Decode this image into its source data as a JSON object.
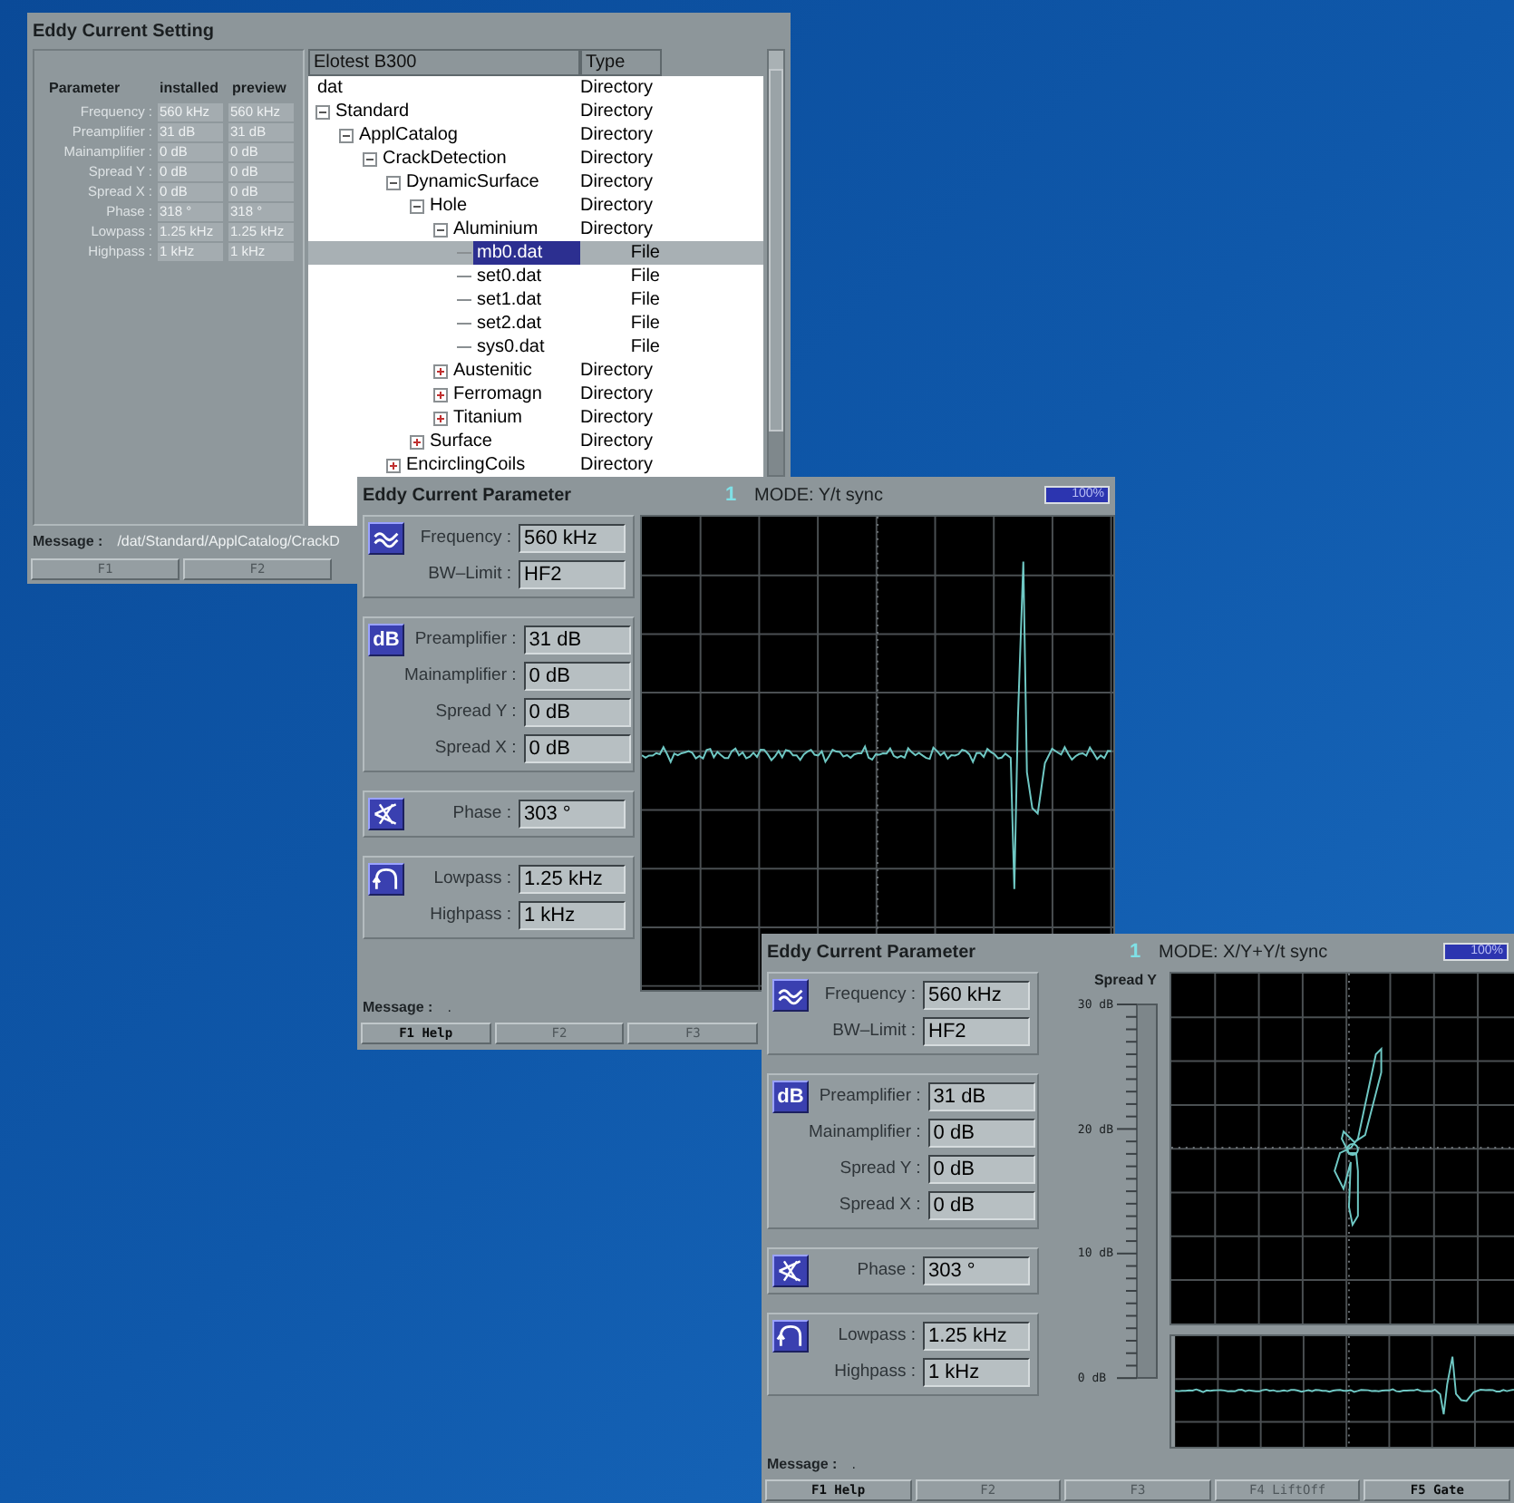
{
  "windows": [
    {
      "kind": "setting",
      "title": "Eddy Current Setting",
      "parameters": {
        "columns": [
          "Parameter",
          "installed",
          "preview"
        ],
        "rows": [
          {
            "label": "Frequency :",
            "installed": "560 kHz",
            "preview": "560 kHz"
          },
          {
            "label": "Preamplifier :",
            "installed": "31 dB",
            "preview": "31 dB"
          },
          {
            "label": "Mainamplifier :",
            "installed": "0 dB",
            "preview": "0 dB"
          },
          {
            "label": "Spread Y :",
            "installed": "0 dB",
            "preview": "0 dB"
          },
          {
            "label": "Spread X :",
            "installed": "0 dB",
            "preview": "0 dB"
          },
          {
            "label": "Phase :",
            "installed": "318 °",
            "preview": "318 °"
          },
          {
            "label": "Lowpass :",
            "installed": "1.25 kHz",
            "preview": "1.25 kHz"
          },
          {
            "label": "Highpass :",
            "installed": "1 kHz",
            "preview": "1 kHz"
          }
        ]
      },
      "tree": {
        "columns": [
          "Elotest B300",
          "Type"
        ],
        "items": [
          {
            "name": "dat",
            "type": "Directory",
            "selected": false,
            "children": [
              {
                "name": "Standard",
                "type": "Directory",
                "expanded": true,
                "selected": false,
                "children": [
                  {
                    "name": "ApplCatalog",
                    "type": "Directory",
                    "expanded": true,
                    "selected": false,
                    "children": [
                      {
                        "name": "CrackDetection",
                        "type": "Directory",
                        "expanded": true,
                        "selected": false,
                        "children": [
                          {
                            "name": "DynamicSurface",
                            "type": "Directory",
                            "expanded": true,
                            "selected": false,
                            "children": [
                              {
                                "name": "Hole",
                                "type": "Directory",
                                "expanded": true,
                                "selected": false,
                                "children": [
                                  {
                                    "name": "Aluminium",
                                    "type": "Directory",
                                    "expanded": true,
                                    "selected": false,
                                    "children": [
                                      {
                                        "name": "mb0.dat",
                                        "type": "File",
                                        "selected": true
                                      },
                                      {
                                        "name": "set0.dat",
                                        "type": "File",
                                        "selected": false
                                      },
                                      {
                                        "name": "set1.dat",
                                        "type": "File",
                                        "selected": false
                                      },
                                      {
                                        "name": "set2.dat",
                                        "type": "File",
                                        "selected": false
                                      },
                                      {
                                        "name": "sys0.dat",
                                        "type": "File",
                                        "selected": false
                                      }
                                    ]
                                  },
                                  {
                                    "name": "Austenitic",
                                    "type": "Directory",
                                    "expanded": false,
                                    "selected": false
                                  },
                                  {
                                    "name": "Ferromagn",
                                    "type": "Directory",
                                    "expanded": false,
                                    "selected": false
                                  },
                                  {
                                    "name": "Titanium",
                                    "type": "Directory",
                                    "expanded": false,
                                    "selected": false
                                  }
                                ]
                              },
                              {
                                "name": "Surface",
                                "type": "Directory",
                                "expanded": false,
                                "selected": false
                              }
                            ]
                          },
                          {
                            "name": "EncirclingCoils",
                            "type": "Directory",
                            "expanded": false,
                            "selected": false
                          }
                        ]
                      }
                    ]
                  }
                ]
              }
            ]
          }
        ]
      },
      "message": {
        "label": "Message :",
        "text": "/dat/Standard/ApplCatalog/CrackD"
      },
      "function_keys": [
        {
          "label": "F1",
          "disabled": true
        },
        {
          "label": "F2",
          "disabled": true
        }
      ]
    },
    {
      "kind": "yt_parameter",
      "title": "Eddy Current Parameter",
      "channel": "1",
      "mode": "MODE: Y/t sync",
      "zoom": "100%",
      "groups": [
        {
          "kind": "frequency",
          "fields": [
            {
              "label": "Frequency :",
              "value": "560 kHz"
            },
            {
              "label": "BW–Limit :",
              "value": "HF2"
            }
          ]
        },
        {
          "kind": "gain",
          "badge": "dB",
          "fields": [
            {
              "label": "Preamplifier :",
              "value": "31 dB"
            },
            {
              "label": "Mainamplifier :",
              "value": "0 dB"
            },
            {
              "label": "Spread Y :",
              "value": "0 dB"
            },
            {
              "label": "Spread X :",
              "value": "0 dB"
            }
          ]
        },
        {
          "kind": "phase",
          "fields": [
            {
              "label": "Phase :",
              "value": "303 °"
            }
          ]
        },
        {
          "kind": "filter",
          "fields": [
            {
              "label": "Lowpass :",
              "value": "1.25 kHz"
            },
            {
              "label": "Highpass :",
              "value": "1 kHz"
            }
          ]
        }
      ],
      "message": {
        "label": "Message :",
        "text": "."
      },
      "function_keys": [
        {
          "label": "F1 Help",
          "disabled": false
        },
        {
          "label": "F2",
          "disabled": true
        },
        {
          "label": "F3",
          "disabled": true
        }
      ]
    },
    {
      "kind": "xy_parameter",
      "title": "Eddy Current Parameter",
      "channel": "1",
      "mode": "MODE: X/Y+Y/t sync",
      "zoom": "100%",
      "spread_scale": {
        "title": "Spread Y",
        "ticks": [
          "30 dB",
          "20 dB",
          "10 dB",
          "0 dB"
        ]
      },
      "groups": [
        {
          "kind": "frequency",
          "fields": [
            {
              "label": "Frequency :",
              "value": "560 kHz"
            },
            {
              "label": "BW–Limit :",
              "value": "HF2"
            }
          ]
        },
        {
          "kind": "gain",
          "badge": "dB",
          "fields": [
            {
              "label": "Preamplifier :",
              "value": "31 dB"
            },
            {
              "label": "Mainamplifier :",
              "value": "0 dB"
            },
            {
              "label": "Spread Y :",
              "value": "0 dB"
            },
            {
              "label": "Spread X :",
              "value": "0 dB"
            }
          ]
        },
        {
          "kind": "phase",
          "fields": [
            {
              "label": "Phase :",
              "value": "303 °"
            }
          ]
        },
        {
          "kind": "filter",
          "fields": [
            {
              "label": "Lowpass :",
              "value": "1.25 kHz"
            },
            {
              "label": "Highpass :",
              "value": "1 kHz"
            }
          ]
        }
      ],
      "message": {
        "label": "Message :",
        "text": "."
      },
      "function_keys": [
        {
          "label": "F1 Help",
          "disabled": false
        },
        {
          "label": "F2",
          "disabled": true
        },
        {
          "label": "F3",
          "disabled": true
        },
        {
          "label": "F4 LiftOff",
          "disabled": true
        },
        {
          "label": "F5 Gate",
          "disabled": false
        }
      ]
    }
  ]
}
